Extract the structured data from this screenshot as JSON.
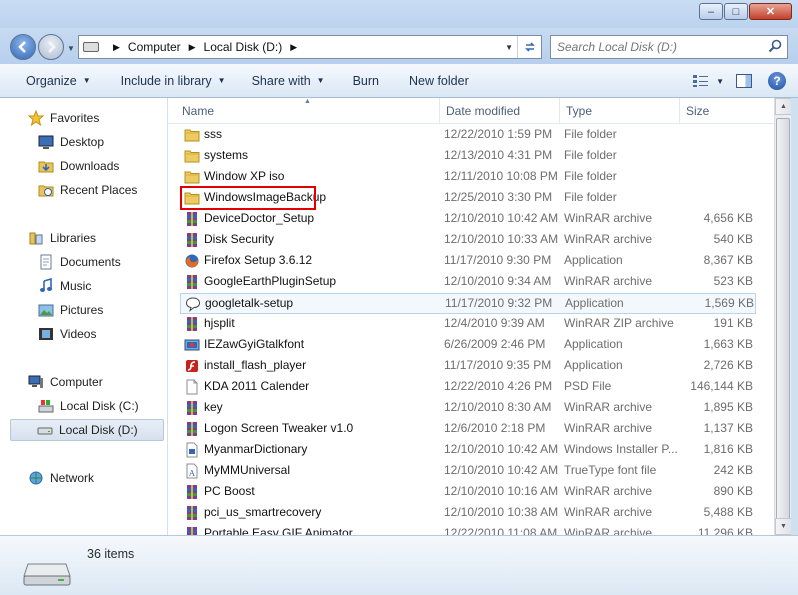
{
  "window": {
    "min_label": "‒",
    "max_label": "□",
    "close_label": "✕"
  },
  "nav": {
    "breadcrumb": [
      "Computer",
      "Local Disk (D:)"
    ],
    "search_placeholder": "Search Local Disk (D:)"
  },
  "toolbar": {
    "organize": "Organize",
    "include_in_library": "Include in library",
    "share_with": "Share with",
    "burn": "Burn",
    "new_folder": "New folder"
  },
  "sidebar": {
    "favorites": "Favorites",
    "desktop": "Desktop",
    "downloads": "Downloads",
    "recent_places": "Recent Places",
    "libraries": "Libraries",
    "documents": "Documents",
    "music": "Music",
    "pictures": "Pictures",
    "videos": "Videos",
    "computer": "Computer",
    "local_c": "Local Disk (C:)",
    "local_d": "Local Disk (D:)",
    "network": "Network"
  },
  "columns": {
    "name": "Name",
    "date": "Date modified",
    "type": "Type",
    "size": "Size"
  },
  "files": [
    {
      "name": "sss",
      "date": "12/22/2010 1:59 PM",
      "type": "File folder",
      "size": "",
      "icon": "folder-icon"
    },
    {
      "name": "systems",
      "date": "12/13/2010 4:31 PM",
      "type": "File folder",
      "size": "",
      "icon": "folder-icon"
    },
    {
      "name": "Window XP iso",
      "date": "12/11/2010 10:08 PM",
      "type": "File folder",
      "size": "",
      "icon": "folder-icon"
    },
    {
      "name": "WindowsImageBackup",
      "date": "12/25/2010 3:30 PM",
      "type": "File folder",
      "size": "",
      "icon": "folder-icon"
    },
    {
      "name": "DeviceDoctor_Setup",
      "date": "12/10/2010 10:42 AM",
      "type": "WinRAR archive",
      "size": "4,656 KB",
      "icon": "winrar-icon"
    },
    {
      "name": "Disk Security",
      "date": "12/10/2010 10:33 AM",
      "type": "WinRAR archive",
      "size": "540 KB",
      "icon": "winrar-icon"
    },
    {
      "name": "Firefox Setup 3.6.12",
      "date": "11/17/2010 9:30 PM",
      "type": "Application",
      "size": "8,367 KB",
      "icon": "firefox-icon"
    },
    {
      "name": "GoogleEarthPluginSetup",
      "date": "12/10/2010 9:34 AM",
      "type": "WinRAR archive",
      "size": "523 KB",
      "icon": "winrar-icon"
    },
    {
      "name": "googletalk-setup",
      "date": "11/17/2010 9:32 PM",
      "type": "Application",
      "size": "1,569 KB",
      "icon": "googletalk-icon"
    },
    {
      "name": "hjsplit",
      "date": "12/4/2010 9:39 AM",
      "type": "WinRAR ZIP archive",
      "size": "191 KB",
      "icon": "winrar-icon"
    },
    {
      "name": "IEZawGyiGtalkfont",
      "date": "6/26/2009 2:46 PM",
      "type": "Application",
      "size": "1,663 KB",
      "icon": "installer-icon"
    },
    {
      "name": "install_flash_player",
      "date": "11/17/2010 9:35 PM",
      "type": "Application",
      "size": "2,726 KB",
      "icon": "flash-icon"
    },
    {
      "name": "KDA 2011 Calender",
      "date": "12/22/2010 4:26 PM",
      "type": "PSD File",
      "size": "146,144 KB",
      "icon": "blank-file-icon"
    },
    {
      "name": "key",
      "date": "12/10/2010 8:30 AM",
      "type": "WinRAR archive",
      "size": "1,895 KB",
      "icon": "winrar-icon"
    },
    {
      "name": "Logon Screen Tweaker v1.0",
      "date": "12/6/2010 2:18 PM",
      "type": "WinRAR archive",
      "size": "1,137 KB",
      "icon": "winrar-icon"
    },
    {
      "name": "MyanmarDictionary",
      "date": "12/10/2010 10:42 AM",
      "type": "Windows Installer P...",
      "size": "1,816 KB",
      "icon": "msi-icon"
    },
    {
      "name": "MyMMUniversal",
      "date": "12/10/2010 10:42 AM",
      "type": "TrueType font file",
      "size": "242 KB",
      "icon": "font-icon"
    },
    {
      "name": "PC Boost",
      "date": "12/10/2010 10:16 AM",
      "type": "WinRAR archive",
      "size": "890 KB",
      "icon": "winrar-icon"
    },
    {
      "name": "pci_us_smartrecovery",
      "date": "12/10/2010 10:38 AM",
      "type": "WinRAR archive",
      "size": "5,488 KB",
      "icon": "winrar-icon"
    },
    {
      "name": "Portable Easy GIF Animator",
      "date": "12/22/2010 11:08 AM",
      "type": "WinRAR archive",
      "size": "11,296 KB",
      "icon": "winrar-icon"
    }
  ],
  "status": {
    "item_count": "36 items"
  },
  "colors": {
    "highlight_box": "#e00000",
    "accent": "#2f68b7"
  }
}
